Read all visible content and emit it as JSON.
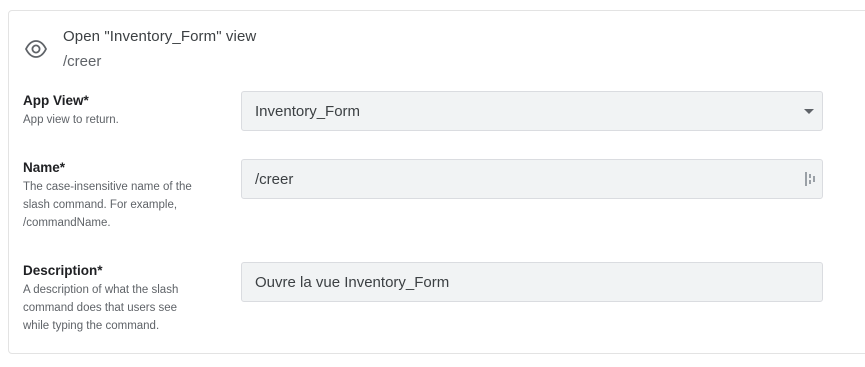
{
  "header": {
    "title": "Open \"Inventory_Form\" view",
    "subtitle": "/creer",
    "icon": "eye-icon"
  },
  "fields": {
    "app_view": {
      "label": "App View*",
      "help": "App view to return.",
      "value": "Inventory_Form"
    },
    "name": {
      "label": "Name*",
      "help_lines": [
        "The case-insensitive name of the",
        "slash command. For example,",
        "/commandName."
      ],
      "value": "/creer"
    },
    "description": {
      "label": "Description*",
      "help_lines": [
        "A description of what the slash",
        "command does that users see",
        "while typing the command."
      ],
      "value": "Ouvre la vue Inventory_Form"
    }
  }
}
